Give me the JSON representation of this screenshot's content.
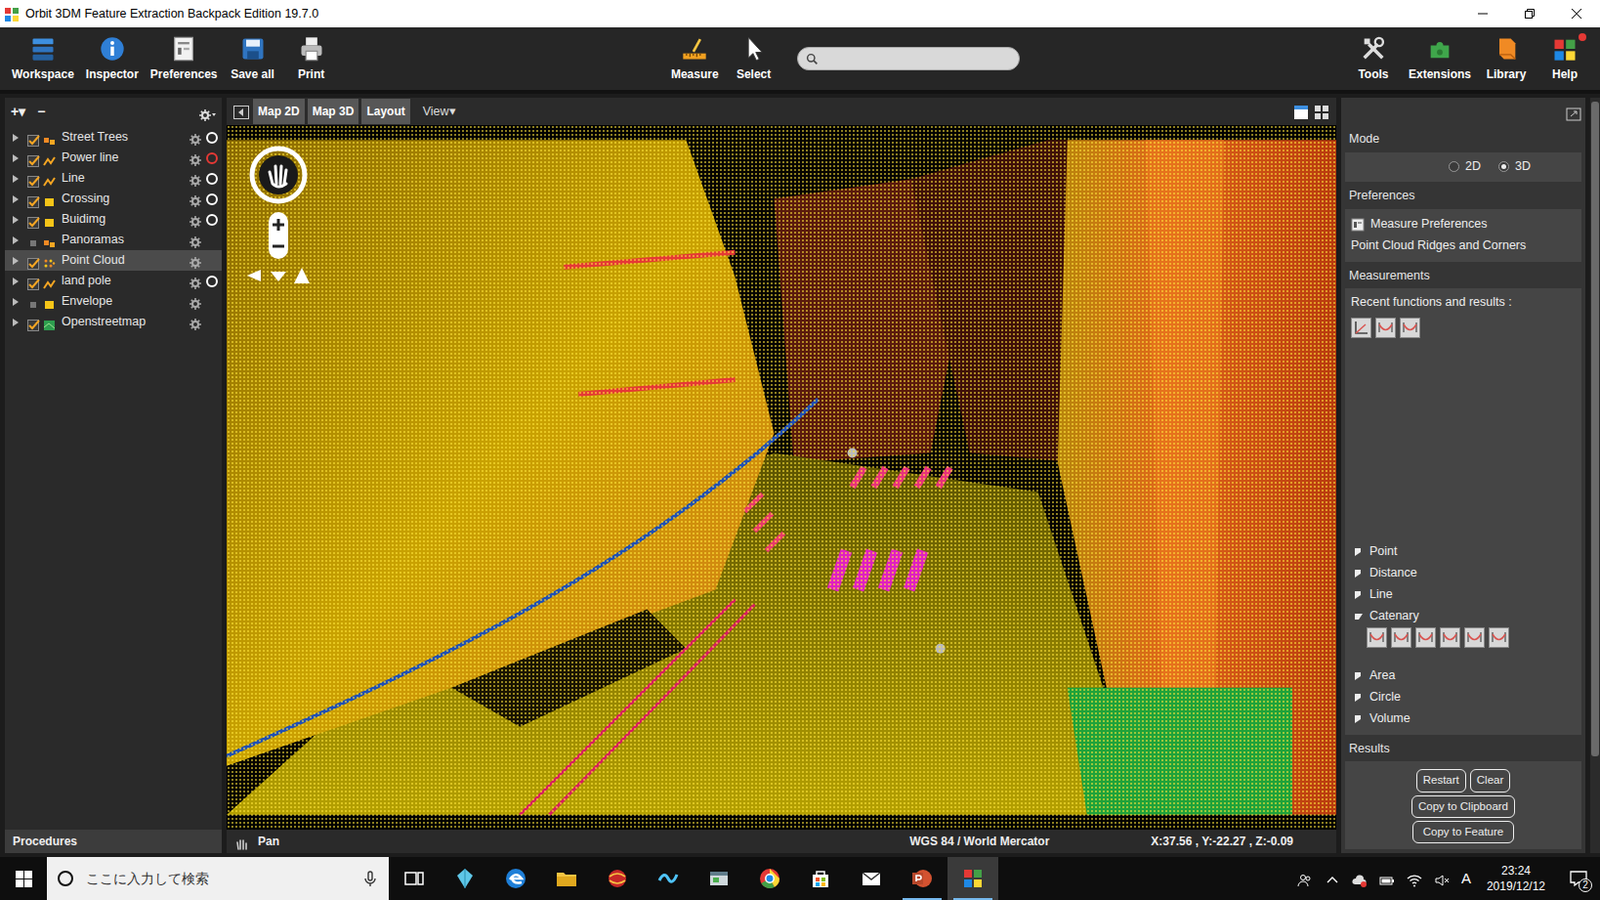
{
  "window": {
    "title": "Orbit 3DM Feature Extraction Backpack Edition 19.7.0"
  },
  "toolbar": {
    "left": [
      {
        "label": "Workspace"
      },
      {
        "label": "Inspector"
      },
      {
        "label": "Preferences"
      },
      {
        "label": "Save all"
      },
      {
        "label": "Print"
      }
    ],
    "center": [
      {
        "label": "Measure"
      },
      {
        "label": "Select"
      }
    ],
    "right": [
      {
        "label": "Tools",
        "alert": false
      },
      {
        "label": "Extensions",
        "alert": false
      },
      {
        "label": "Library",
        "alert": false
      },
      {
        "label": "Help",
        "alert": true
      }
    ]
  },
  "layers": {
    "add": "+▾",
    "remove": "−",
    "items": [
      {
        "name": "Street Trees",
        "expanded": false,
        "checked": true,
        "selected": false,
        "kind": "point",
        "snap": true,
        "snap_color": "#ffffff"
      },
      {
        "name": "Power line",
        "expanded": false,
        "checked": true,
        "selected": false,
        "kind": "line",
        "snap": true,
        "snap_color": "#e53935"
      },
      {
        "name": "Line",
        "expanded": false,
        "checked": true,
        "selected": false,
        "kind": "line",
        "snap": true,
        "snap_color": "#ffffff"
      },
      {
        "name": "Crossing",
        "expanded": false,
        "checked": true,
        "selected": false,
        "kind": "polygon",
        "snap": true,
        "snap_color": "#ffffff"
      },
      {
        "name": "Buidimg",
        "expanded": false,
        "checked": true,
        "selected": false,
        "kind": "polygon",
        "snap": true,
        "snap_color": "#ffffff"
      },
      {
        "name": "Panoramas",
        "expanded": false,
        "checked": false,
        "selected": false,
        "kind": "point",
        "snap": false
      },
      {
        "name": "Point Cloud",
        "expanded": false,
        "checked": true,
        "selected": true,
        "kind": "cloud",
        "snap": false
      },
      {
        "name": "land pole",
        "expanded": false,
        "checked": true,
        "selected": false,
        "kind": "line",
        "snap": true,
        "snap_color": "#ffffff"
      },
      {
        "name": "Envelope",
        "expanded": false,
        "checked": false,
        "selected": false,
        "kind": "polygon",
        "snap": false
      },
      {
        "name": "Openstreetmap",
        "expanded": false,
        "checked": true,
        "selected": false,
        "kind": "map",
        "snap": false
      }
    ],
    "footer": "Procedures"
  },
  "view": {
    "tabs": [
      {
        "label": "Map 2D",
        "selected": false
      },
      {
        "label": "Map 3D",
        "selected": false
      },
      {
        "label": "Layout",
        "selected": false
      }
    ],
    "menu": "View▾",
    "status": {
      "tool": "Pan",
      "crs": "WGS 84 / World Mercator",
      "coords": "X:37.56 , Y:-22.27 , Z:-0.09"
    }
  },
  "measure_panel": {
    "mode": {
      "title": "Mode",
      "options": [
        {
          "label": "2D",
          "selected": false
        },
        {
          "label": "3D",
          "selected": true
        }
      ]
    },
    "preferences": {
      "title": "Preferences",
      "items": [
        "Measure Preferences",
        "Point Cloud Ridges and Corners"
      ]
    },
    "measurements": {
      "title": "Measurements",
      "recent_label": "Recent functions and results :",
      "recent": [
        {
          "kind": "line"
        },
        {
          "kind": "catenary"
        },
        {
          "kind": "catenary"
        }
      ],
      "groups": [
        {
          "label": "Point",
          "expanded": false
        },
        {
          "label": "Distance",
          "expanded": false
        },
        {
          "label": "Line",
          "expanded": false
        },
        {
          "label": "Catenary",
          "expanded": true,
          "tools": [
            {
              "kind": "catenary"
            },
            {
              "kind": "catenary"
            },
            {
              "kind": "catenary"
            },
            {
              "kind": "catenary"
            },
            {
              "kind": "catenary"
            },
            {
              "kind": "catenary"
            }
          ]
        },
        {
          "label": "Area",
          "expanded": false
        },
        {
          "label": "Circle",
          "expanded": false
        },
        {
          "label": "Volume",
          "expanded": false
        }
      ]
    },
    "results": {
      "title": "Results",
      "buttons": [
        {
          "label": "Restart",
          "disabled": true
        },
        {
          "label": "Clear",
          "disabled": true
        },
        {
          "label": "Copy to Clipboard",
          "disabled": true
        },
        {
          "label": "Copy to Feature",
          "disabled": true
        }
      ]
    }
  },
  "taskbar": {
    "search": {
      "placeholder": "ここに入力して検索"
    },
    "apps": [
      {
        "running": false,
        "active": false
      },
      {
        "running": false,
        "active": false
      },
      {
        "running": false,
        "active": false
      },
      {
        "running": false,
        "active": false
      },
      {
        "running": false,
        "active": false
      },
      {
        "running": false,
        "active": false
      },
      {
        "running": false,
        "active": false
      },
      {
        "running": false,
        "active": false
      },
      {
        "running": false,
        "active": false
      },
      {
        "running": false,
        "active": false
      },
      {
        "running": true,
        "active": false
      },
      {
        "running": true,
        "active": true
      }
    ],
    "ime": "A",
    "time": "23:24",
    "date": "2019/12/12",
    "notifications": "2"
  }
}
